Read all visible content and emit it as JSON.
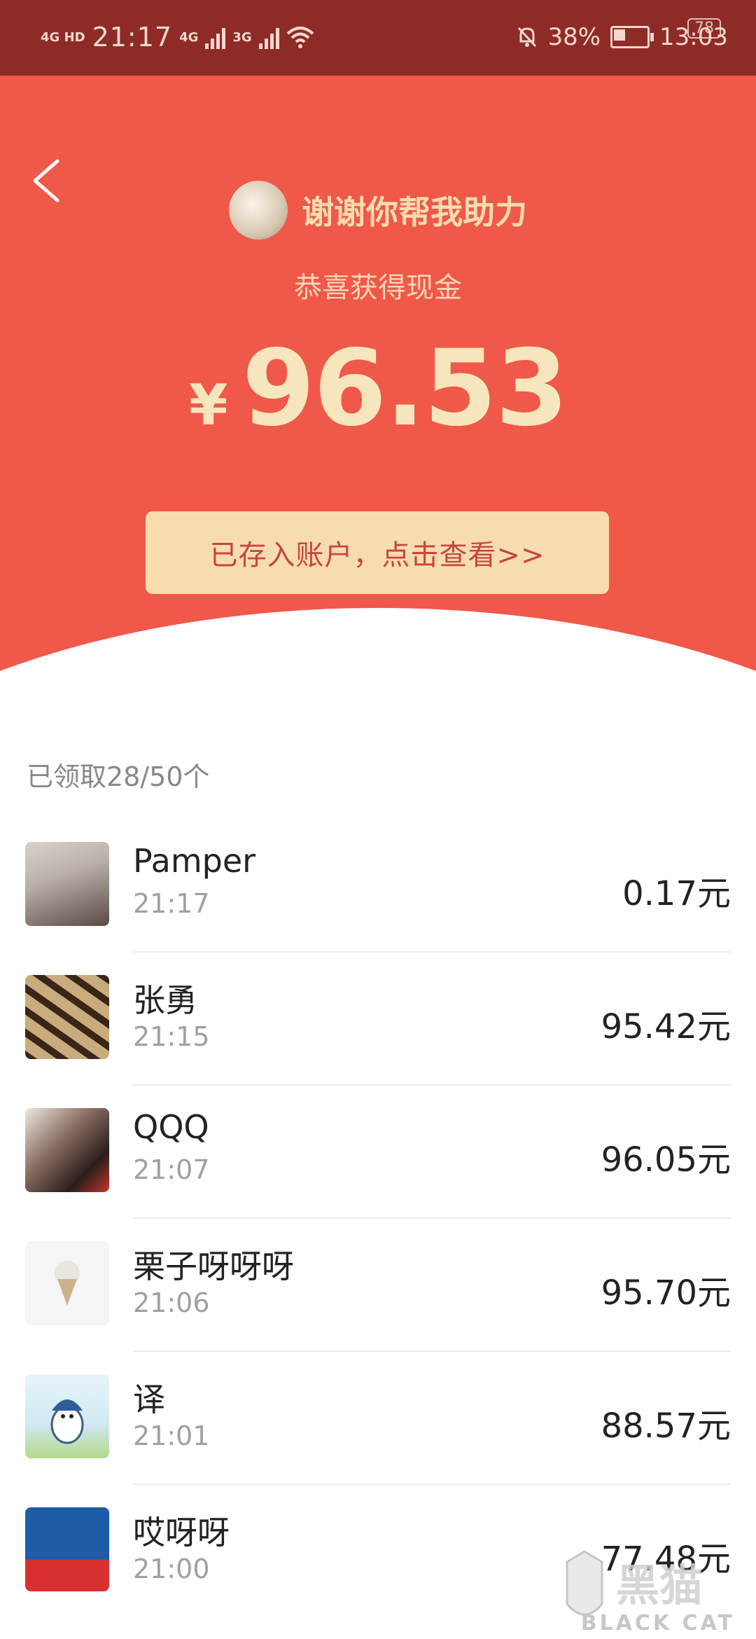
{
  "status_bar": {
    "time_left": "21:17",
    "network_left": "4G HD",
    "network_mid_1": "4G",
    "network_mid_2": "3G",
    "battery_percent": "38%",
    "time_right": "13:03",
    "badge": "78"
  },
  "header": {
    "sender_message": "谢谢你帮我助力",
    "subtitle": "恭喜获得现金",
    "currency": "¥",
    "amount": "96.53",
    "view_button": "已存入账户，点击查看>>"
  },
  "summary": {
    "claimed": "已领取28/50个"
  },
  "recipients": [
    {
      "name": "Pamper",
      "time": "21:17",
      "amount": "0.17元"
    },
    {
      "name": "张勇",
      "time": "21:15",
      "amount": "95.42元"
    },
    {
      "name": "QQQ",
      "time": "21:07",
      "amount": "96.05元"
    },
    {
      "name": "栗子呀呀呀",
      "time": "21:06",
      "amount": "95.70元"
    },
    {
      "name": "译",
      "time": "21:01",
      "amount": "88.57元"
    },
    {
      "name": "哎呀呀",
      "time": "21:00",
      "amount": "77.48元"
    }
  ],
  "watermark": {
    "brand_en": "BLACK CAT",
    "brand_cn": "黑猫"
  },
  "colors": {
    "header_red": "#f0584a",
    "gold": "#f7dcae",
    "status_bar": "#8f2b26"
  }
}
